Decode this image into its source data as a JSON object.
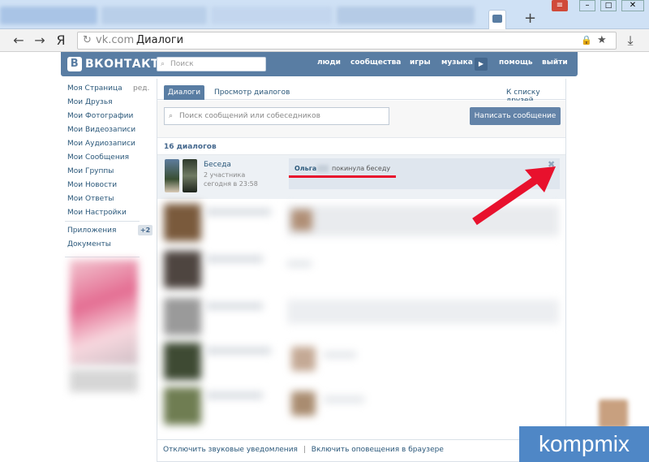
{
  "browser": {
    "url_host": "vk.com",
    "url_title": "Диалоги",
    "yandex_logo": "Я"
  },
  "vk": {
    "logo": "ВКОНТАКТЕ",
    "search_placeholder": "Поиск",
    "nav": [
      "люди",
      "сообщества",
      "игры",
      "музыка",
      "помощь",
      "выйти"
    ]
  },
  "menu": {
    "items": [
      "Моя Страница",
      "Мои Друзья",
      "Мои Фотографии",
      "Мои Видеозаписи",
      "Мои Аудиозаписи",
      "Мои Сообщения",
      "Мои Группы",
      "Мои Новости",
      "Мои Ответы",
      "Мои Настройки"
    ],
    "edit": "ред.",
    "apps": "Приложения",
    "apps_badge": "+2",
    "docs": "Документы"
  },
  "dialogs": {
    "tab_active": "Диалоги",
    "tab_view": "Просмотр диалогов",
    "friends_link": "К списку друзей",
    "search_placeholder": "Поиск сообщений или собеседников",
    "write_button": "Написать сообщение",
    "count_label": "16 диалогов",
    "conversation": {
      "title": "Беседа",
      "participants": "2 участника",
      "time": "сегодня в 23:58",
      "sender": "Ольга",
      "message": "покинула беседу"
    }
  },
  "footer": {
    "sound": "Отключить звуковые уведомления",
    "separator": "|",
    "browser_notify": "Включить оповещения в браузере"
  },
  "watermark": "kompmix",
  "colors": {
    "vk_blue": "#597da3",
    "link": "#2b587a",
    "arrow": "#e8112d",
    "watermark_bg": "#4f87c6"
  }
}
